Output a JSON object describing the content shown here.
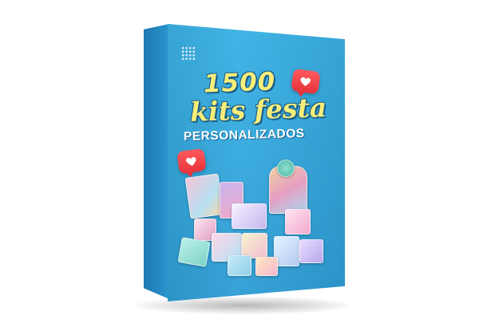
{
  "product": {
    "number": "1500",
    "title": "kits festa",
    "subtitle": "PERSONALIZADOS"
  },
  "icons": [
    "like-heart-icon",
    "like-heart-icon"
  ],
  "colors": {
    "box_face": "#35a9de",
    "box_spine": "#1d78b3",
    "title_text": "#f6ee7a",
    "subtitle_text": "#ffffff",
    "badge": "#e8333b"
  }
}
